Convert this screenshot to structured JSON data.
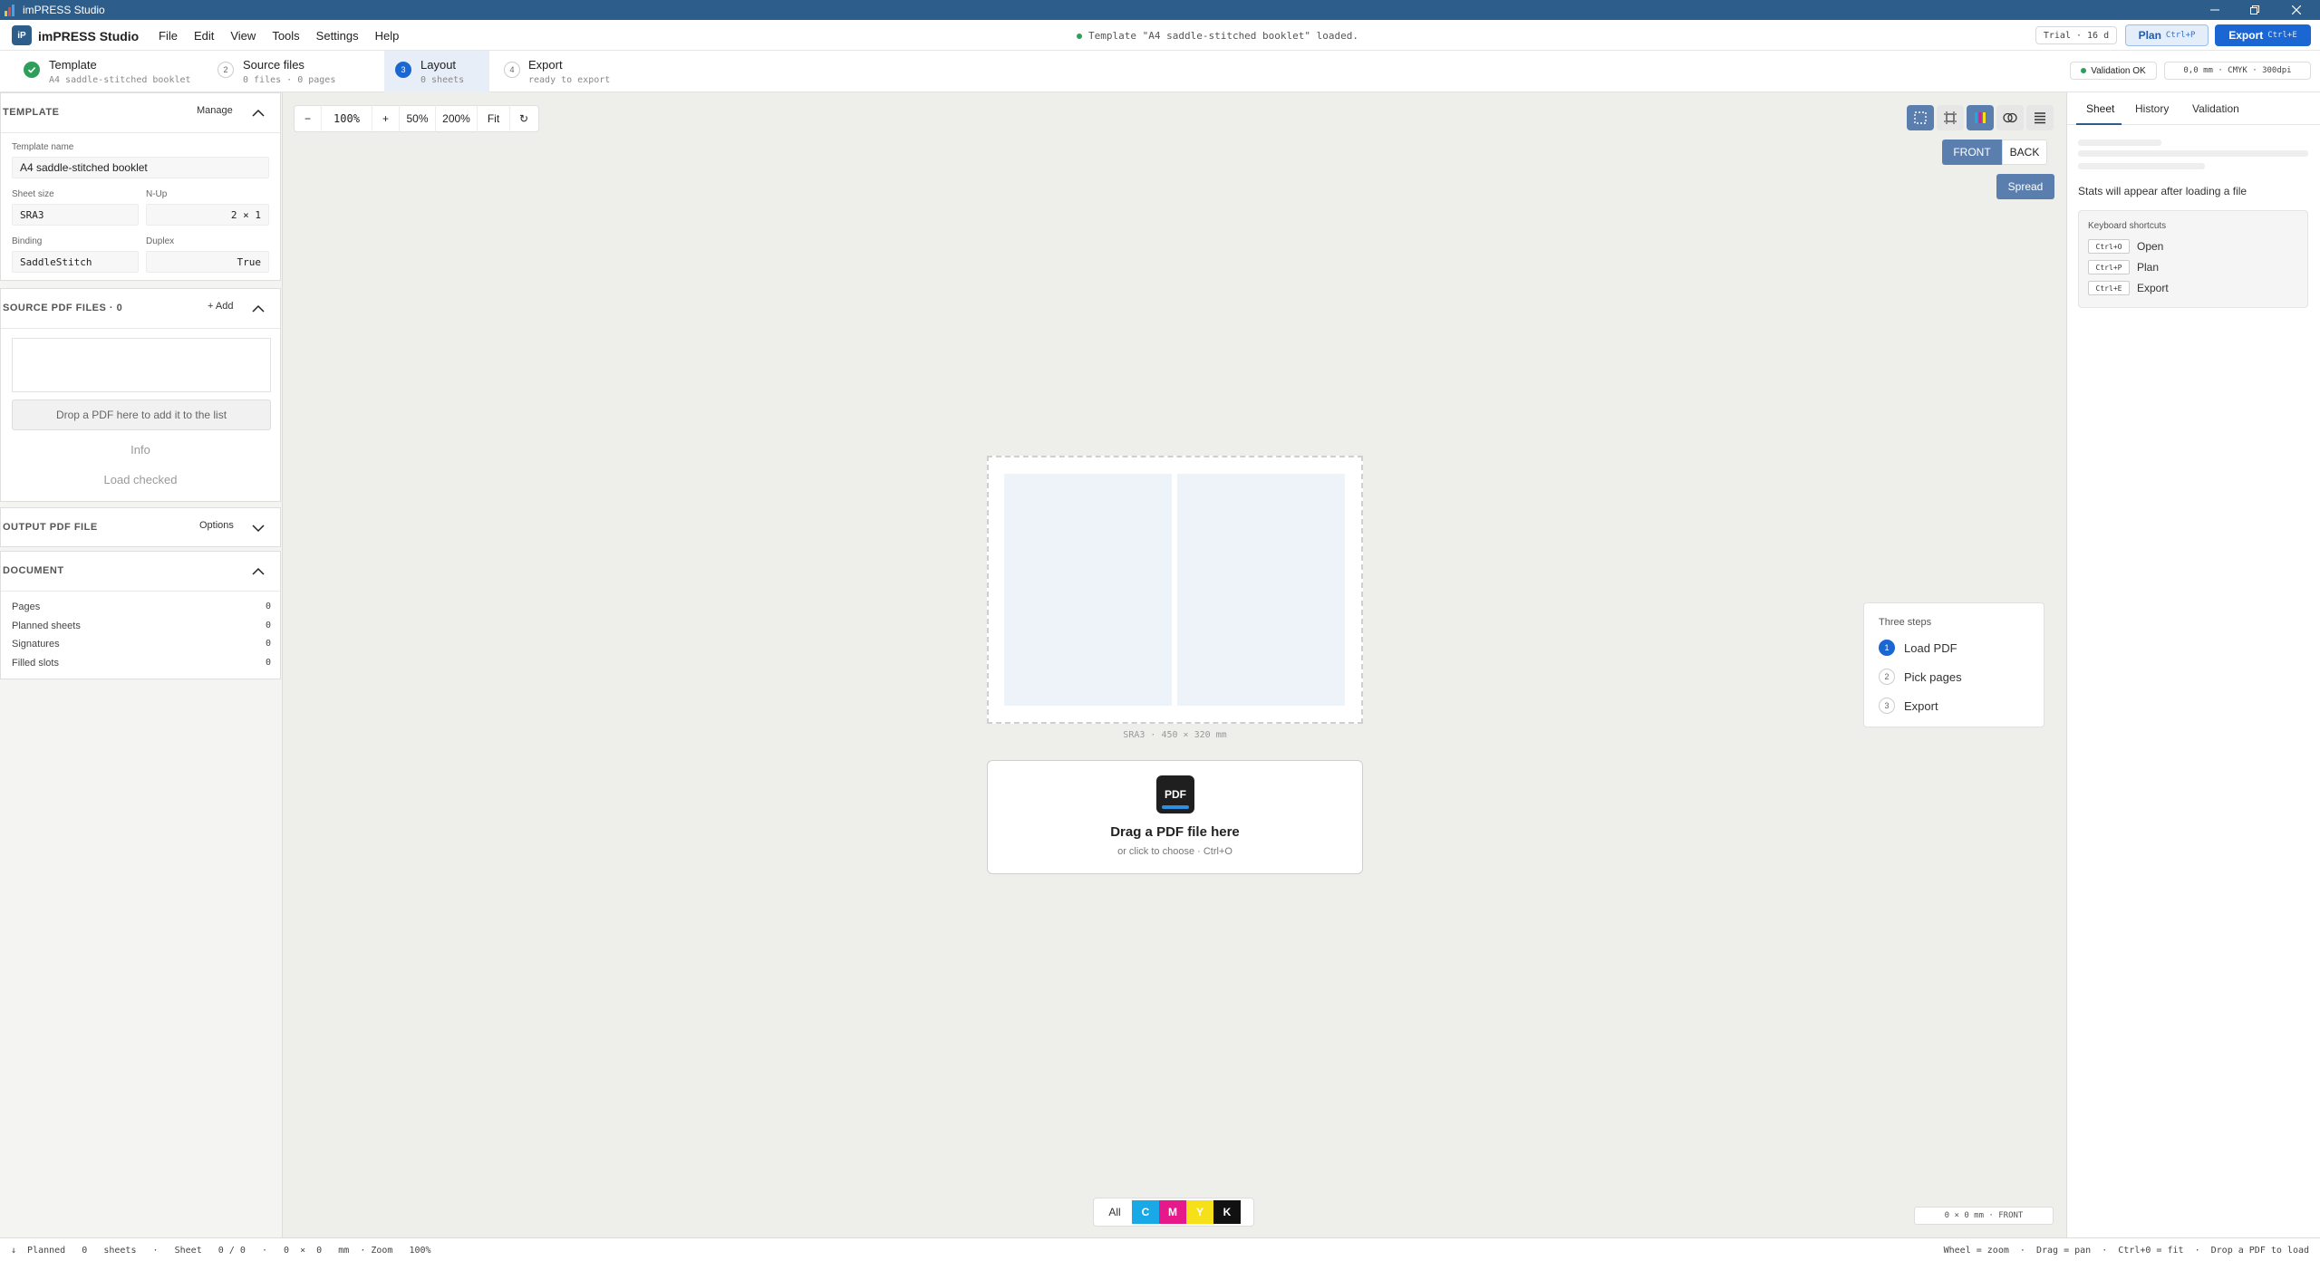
{
  "window": {
    "title": "imPRESS Studio"
  },
  "app": {
    "logo": "iP",
    "name": "imPRESS Studio"
  },
  "menu": [
    "File",
    "Edit",
    "View",
    "Tools",
    "Settings",
    "Help"
  ],
  "status_message": "Template \"A4 saddle-stitched booklet\" loaded.",
  "trial_badge": "Trial · 16 d",
  "plan_button": {
    "label": "Plan",
    "shortcut": "Ctrl+P"
  },
  "export_button": {
    "label": "Export",
    "shortcut": "Ctrl+E"
  },
  "steps": [
    {
      "num": "1",
      "title": "Template",
      "sub": "A4 saddle-stitched booklet",
      "state": "done"
    },
    {
      "num": "2",
      "title": "Source files",
      "sub": "0  files  ·  0  pages",
      "state": "todo"
    },
    {
      "num": "3",
      "title": "Layout",
      "sub": "0  sheets",
      "state": "active"
    },
    {
      "num": "4",
      "title": "Export",
      "sub": "ready to export",
      "state": "todo"
    }
  ],
  "validation_badge": "Validation OK",
  "meta_badge": "0,0 mm  · CMYK · 300dpi",
  "template_section": {
    "title": "TEMPLATE",
    "action": "Manage",
    "name_label": "Template name",
    "name_value": "A4 saddle-stitched booklet",
    "sheet_size_label": "Sheet size",
    "sheet_size_value": "SRA3",
    "nup_label": "N-Up",
    "nup_value": "2 × 1",
    "binding_label": "Binding",
    "binding_value": "SaddleStitch",
    "duplex_label": "Duplex",
    "duplex_value": "True"
  },
  "source_section": {
    "title": "SOURCE PDF FILES · 0",
    "action": "+ Add",
    "drop_hint": "Drop a PDF here to add it to the list",
    "info": "Info",
    "load_checked": "Load checked"
  },
  "output_section": {
    "title": "OUTPUT PDF FILE",
    "action": "Options"
  },
  "document_section": {
    "title": "DOCUMENT",
    "rows": [
      {
        "label": "Pages",
        "value": "0"
      },
      {
        "label": "Planned sheets",
        "value": "0"
      },
      {
        "label": "Signatures",
        "value": "0"
      },
      {
        "label": "Filled slots",
        "value": "0"
      }
    ]
  },
  "zoom": {
    "minus": "−",
    "value": "100%",
    "plus": "+",
    "p50": "50%",
    "p200": "200%",
    "fit": "Fit",
    "reset": "↻"
  },
  "view_toggle": {
    "front": "FRONT",
    "back": "BACK",
    "spread": "Spread"
  },
  "sheet_label": "SRA3  ·  450  ×  320  mm",
  "dropzone": {
    "icon": "PDF",
    "title": "Drag a PDF file here",
    "sub": "or click to choose · Ctrl+O"
  },
  "three_steps": {
    "title": "Three steps",
    "items": [
      {
        "num": "1",
        "label": "Load PDF"
      },
      {
        "num": "2",
        "label": "Pick pages"
      },
      {
        "num": "3",
        "label": "Export"
      }
    ]
  },
  "channels": [
    {
      "label": "All",
      "color": "#ffffff",
      "text": "#333333"
    },
    {
      "label": "C",
      "color": "#19a9e6",
      "text": "#ffffff"
    },
    {
      "label": "M",
      "color": "#e5198a",
      "text": "#ffffff"
    },
    {
      "label": "Y",
      "color": "#f6e01a",
      "text": "#ffffff"
    },
    {
      "label": "K",
      "color": "#111111",
      "text": "#ffffff"
    }
  ],
  "coords": "0  ×  0   mm  ·  FRONT",
  "right_tabs": [
    "Sheet",
    "History",
    "Validation"
  ],
  "stats_message": "Stats will appear after loading a file",
  "shortcuts": {
    "title": "Keyboard shortcuts",
    "items": [
      {
        "key": "Ctrl+O",
        "label": "Open"
      },
      {
        "key": "Ctrl+P",
        "label": "Plan"
      },
      {
        "key": "Ctrl+E",
        "label": "Export"
      }
    ]
  },
  "status_left": "↓  Planned   0   sheets   ·   Sheet   0 / 0   ·   0  ×  0   mm  · Zoom   100%",
  "status_right": "Wheel = zoom  ·  Drag = pan  ·  Ctrl+0 = fit  ·  Drop a PDF to load",
  "colors": {
    "accent": "#1a66d2",
    "titlebar": "#2c5d8b",
    "ok": "#2e9e5b"
  }
}
